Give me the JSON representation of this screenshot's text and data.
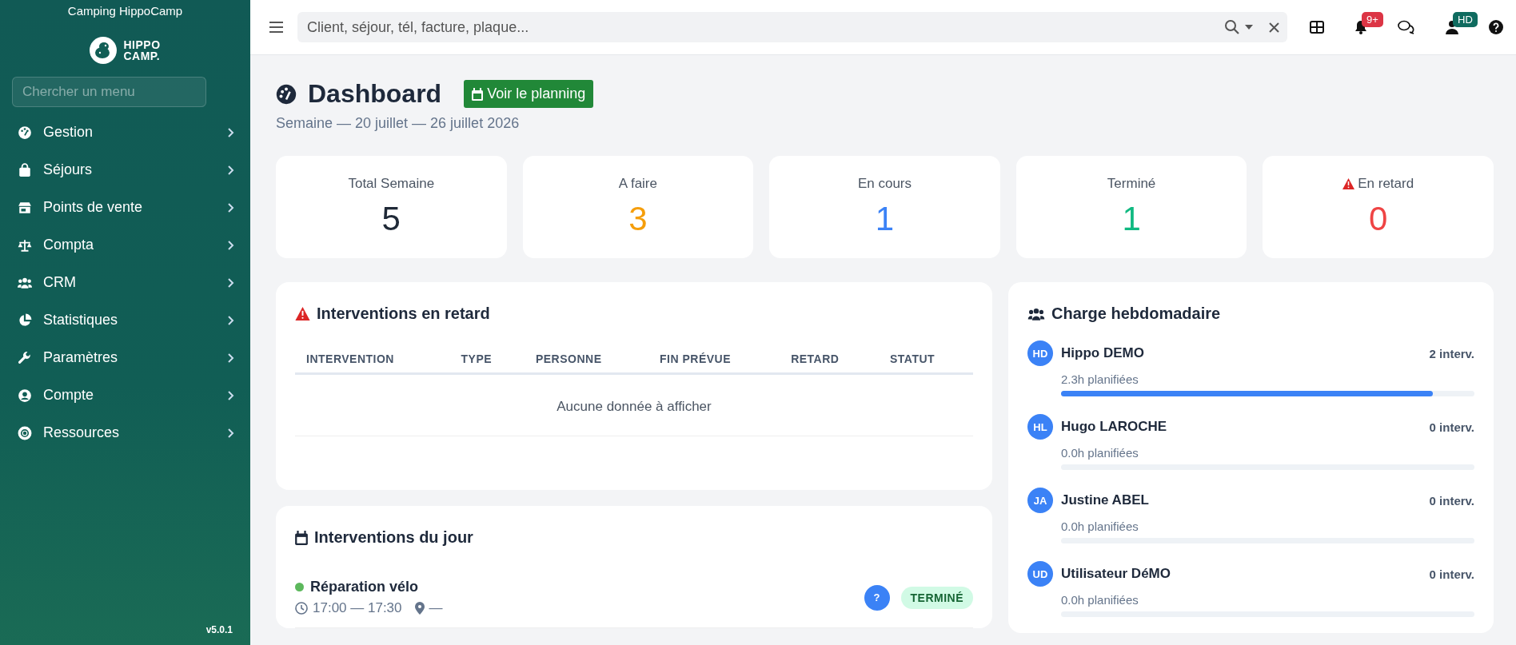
{
  "sidebar": {
    "org_name": "Camping HippoCamp",
    "logo_lines": [
      "HIPPO",
      "CAMP."
    ],
    "search": {
      "placeholder": "Chercher un menu"
    },
    "items": [
      {
        "label": "Gestion",
        "selected": false
      },
      {
        "label": "Séjours",
        "selected": false
      },
      {
        "label": "Points de vente",
        "selected": false
      },
      {
        "label": "Compta",
        "selected": false
      },
      {
        "label": "CRM",
        "selected": false
      },
      {
        "label": "Statistiques",
        "selected": false
      },
      {
        "label": "Paramètres",
        "selected": false
      },
      {
        "label": "Compte",
        "selected": false
      },
      {
        "label": "Ressources",
        "selected": false
      }
    ],
    "version": "v5.0.1"
  },
  "topbar": {
    "search": {
      "placeholder": "Client, séjour, tél, facture, plaque..."
    },
    "notifications_badge": "9+",
    "user_badge": "HD"
  },
  "header": {
    "title": "Dashboard",
    "button": "Voir le planning",
    "subtitle": "Semaine — 20 juillet — 26 juillet 2026"
  },
  "stats": [
    {
      "kind": "plain",
      "label": "Total Semaine",
      "value": "5",
      "color": "#1f2937"
    },
    {
      "kind": "plain",
      "label": "A faire",
      "value": "3",
      "color": "#f59e0b"
    },
    {
      "kind": "plain",
      "label": "En cours",
      "value": "1",
      "color": "#3b82f6"
    },
    {
      "kind": "plain",
      "label": "Terminé",
      "value": "1",
      "color": "#10b981"
    },
    {
      "kind": "alert",
      "label": "En retard",
      "value": "0",
      "color": "#ef4444"
    }
  ],
  "late_panel": {
    "title": "Interventions en retard",
    "columns": [
      "INTERVENTION",
      "TYPE",
      "PERSONNE",
      "FIN PRÉVUE",
      "RETARD",
      "STATUT"
    ],
    "empty": "Aucune donnée à afficher"
  },
  "today_panel": {
    "title": "Interventions du jour",
    "items": [
      {
        "title": "Réparation vélo",
        "color": "#5cb85c",
        "time": "17:00 — 17:30",
        "place": "—",
        "assignee": "?",
        "status": "TERMINÉ"
      }
    ]
  },
  "charge_panel": {
    "title": "Charge hebdomadaire",
    "people": [
      {
        "initials": "HD",
        "name": "Hippo DEMO",
        "count": "2 interv.",
        "hours": "2.3h planifiées",
        "level": 0.9
      },
      {
        "initials": "HL",
        "name": "Hugo LAROCHE",
        "count": "0 interv.",
        "hours": "0.0h planifiées",
        "level": 0
      },
      {
        "initials": "JA",
        "name": "Justine ABEL",
        "count": "0 interv.",
        "hours": "0.0h planifiées",
        "level": 0
      },
      {
        "initials": "UD",
        "name": "Utilisateur DéMO",
        "count": "0 interv.",
        "hours": "0.0h planifiées",
        "level": 0
      }
    ]
  }
}
